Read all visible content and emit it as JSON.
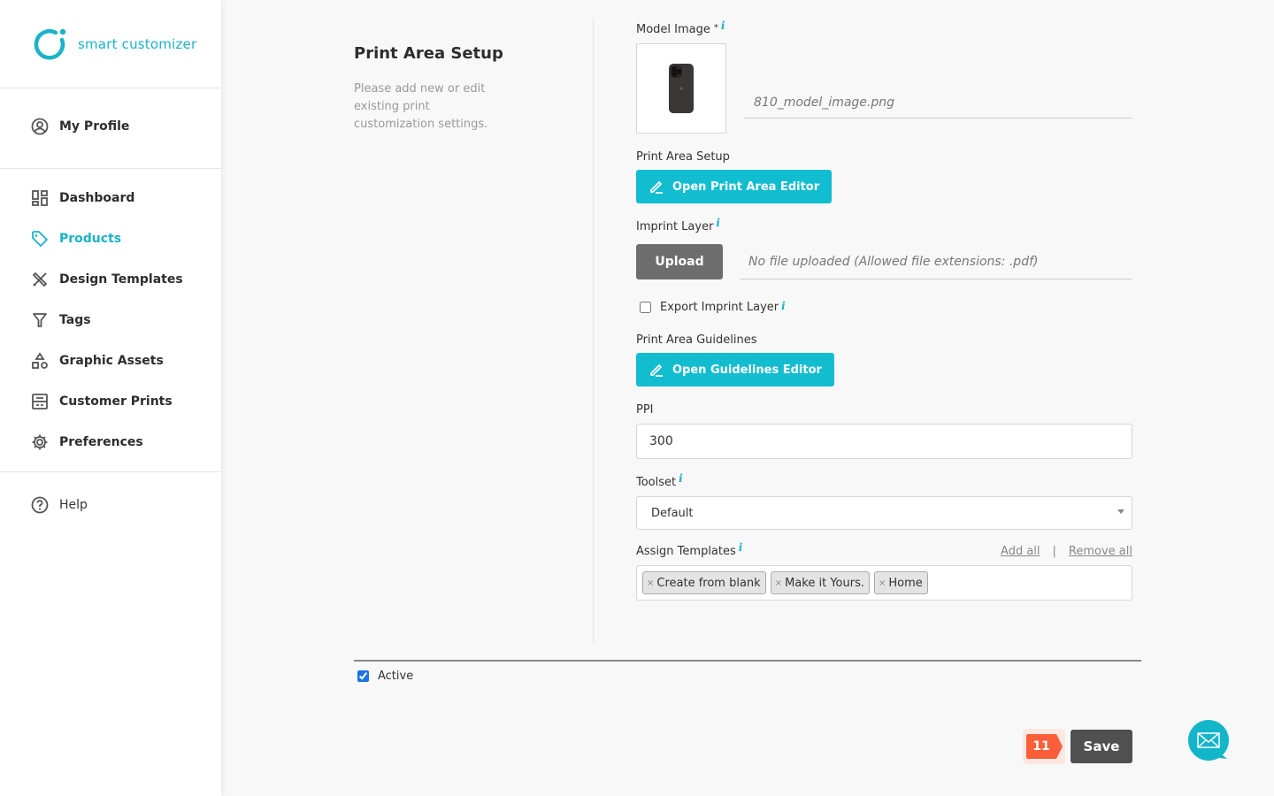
{
  "app": {
    "brand": "smart customizer",
    "accent": "#13bdd0"
  },
  "sidebar": {
    "profile": {
      "label": "My Profile",
      "icon": "user-circle-icon"
    },
    "items": [
      {
        "label": "Dashboard",
        "icon": "dashboard-icon",
        "active": false
      },
      {
        "label": "Products",
        "icon": "tag-icon",
        "active": true
      },
      {
        "label": "Design Templates",
        "icon": "design-tools-icon",
        "active": false
      },
      {
        "label": "Tags",
        "icon": "filter-icon",
        "active": false
      },
      {
        "label": "Graphic Assets",
        "icon": "shapes-icon",
        "active": false
      },
      {
        "label": "Customer Prints",
        "icon": "prints-icon",
        "active": false
      },
      {
        "label": "Preferences",
        "icon": "gear-icon",
        "active": false
      }
    ],
    "help": {
      "label": "Help",
      "icon": "help-icon"
    }
  },
  "section": {
    "title": "Print Area Setup",
    "description": "Please add new or edit existing print customization settings."
  },
  "form": {
    "model_image": {
      "label": "Model Image",
      "required_mark": "*",
      "filename": "810_model_image.png"
    },
    "print_area": {
      "label": "Print Area Setup",
      "button": "Open Print Area Editor"
    },
    "imprint_layer": {
      "label": "Imprint Layer",
      "button": "Upload",
      "status": "No file uploaded (Allowed file extensions: .pdf)"
    },
    "export_imprint": {
      "label": "Export Imprint Layer",
      "checked": false
    },
    "guidelines": {
      "label": "Print Area Guidelines",
      "button": "Open Guidelines Editor"
    },
    "ppi": {
      "label": "PPI",
      "value": "300"
    },
    "toolset": {
      "label": "Toolset",
      "selected": "Default"
    },
    "templates": {
      "label": "Assign Templates",
      "add_all": "Add all",
      "separator": "|",
      "remove_all": "Remove all",
      "tags": [
        "Create from blank",
        "Make it Yours.",
        "Home"
      ],
      "remove_glyph": "×"
    },
    "info_glyph": "i"
  },
  "footer": {
    "active": {
      "label": "Active",
      "checked": true
    },
    "badge_count": "11",
    "save": "Save"
  }
}
